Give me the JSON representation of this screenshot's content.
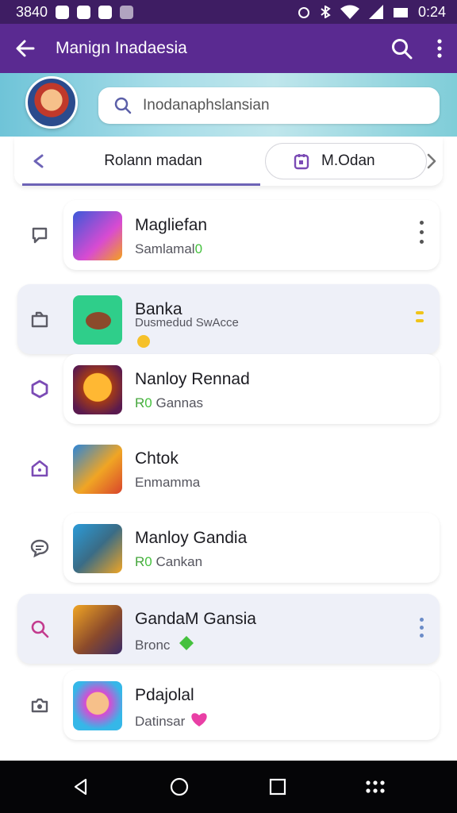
{
  "status_bar": {
    "left_text": "3840",
    "time": "0:24"
  },
  "app_bar": {
    "title": "Manign Inadaesia"
  },
  "search": {
    "value": "Inodanaphslansian"
  },
  "tabs": {
    "tab_one": "Rolann madan",
    "tab_two": "M.Odan"
  },
  "items": [
    {
      "title": "Magliefan",
      "subtitle": "Samlamal",
      "subtitle_badge": "0"
    },
    {
      "title": "Banka",
      "subtitle": "Dusmedud SwAcce"
    },
    {
      "title": "Nanloy Rennad",
      "subtitle_prefix": "R",
      "subtitle_badge": "0",
      "subtitle": "Gannas"
    },
    {
      "title": "Chtok",
      "subtitle": "Enmamma"
    },
    {
      "title": "Manloy Gandia",
      "subtitle_prefix": "R",
      "subtitle_badge": "0",
      "subtitle": "Cankan"
    },
    {
      "title": "GandaM Gansia",
      "subtitle": "Bronc"
    },
    {
      "title": "Pdajolal",
      "subtitle": "Datinsar"
    }
  ],
  "colors": {
    "status_bar": "#3e1d63",
    "app_bar": "#5a2a91",
    "accent": "#6d63b6",
    "icon_purple": "#7b4bb5",
    "badge_green": "#45c13e",
    "menu_yellow": "#f0c419",
    "heart_pink": "#e93fa5"
  },
  "icons": [
    "back-arrow-icon",
    "search-icon",
    "more-vert-icon",
    "chevron-left-icon",
    "calendar-icon",
    "chevron-right-icon",
    "chat-icon",
    "bag-icon",
    "hexagon-icon",
    "home-icon",
    "message-icon",
    "magnifier-icon",
    "camera-icon",
    "nav-back-icon",
    "nav-home-icon",
    "nav-recents-icon",
    "nav-grid-icon"
  ]
}
